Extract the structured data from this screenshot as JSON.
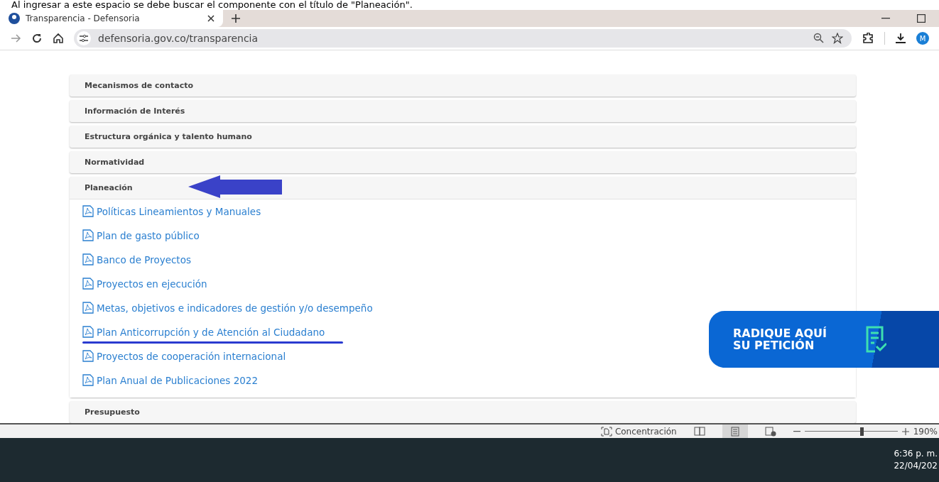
{
  "caption": "Al ingresar a este espacio se debe buscar el componente con el título de \"Planeación\".",
  "browser": {
    "tab": {
      "title": "Transparencia - Defensoria",
      "selected": true
    },
    "url": "defensoria.gov.co/transparencia",
    "profile": "M"
  },
  "accordion": [
    {
      "title": "Mecanismos de contacto",
      "expanded": false
    },
    {
      "title": "Información de Interés",
      "expanded": false
    },
    {
      "title": "Estructura orgánica y talento humano",
      "expanded": false
    },
    {
      "title": "Normatividad",
      "expanded": false
    },
    {
      "title": "Planeación",
      "expanded": true,
      "links": [
        {
          "label": "Políticas Lineamientos y Manuales",
          "underlined": false
        },
        {
          "label": "Plan de gasto público",
          "underlined": false
        },
        {
          "label": "Banco de Proyectos",
          "underlined": false
        },
        {
          "label": "Proyectos en ejecución",
          "underlined": false
        },
        {
          "label": "Metas, objetivos e indicadores de gestión y/o desempeño",
          "underlined": false
        },
        {
          "label": "Plan Anticorrupción y de Atención al Ciudadano",
          "underlined": true
        },
        {
          "label": "Proyectos de cooperación internacional",
          "underlined": false
        },
        {
          "label": "Plan Anual de Publicaciones 2022",
          "underlined": false
        }
      ]
    },
    {
      "title": "Presupuesto",
      "expanded": false
    }
  ],
  "banner": {
    "line_1": "RADIQUE AQUÍ",
    "line_2": "SU PETICIÓN"
  },
  "status_bar": {
    "focus": "Concentración",
    "views": [
      {
        "kind": "read",
        "selected": false
      },
      {
        "kind": "print",
        "selected": true
      },
      {
        "kind": "web",
        "selected": false
      }
    ],
    "zoom": {
      "level": 0.61,
      "reading": "190%"
    }
  },
  "taskbar": {
    "time": "6:36 p. m.",
    "date": "22/04/202"
  }
}
